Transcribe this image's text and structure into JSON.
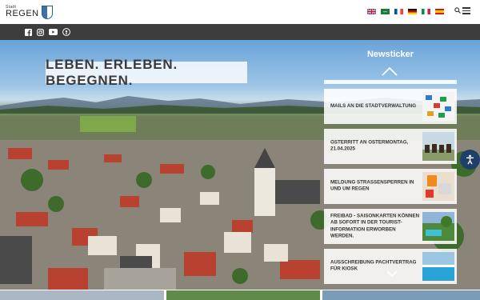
{
  "header": {
    "logo_small": "Stadt",
    "logo_big": "REGEN",
    "languages": [
      "english",
      "arabic",
      "french",
      "german",
      "italian",
      "spanish"
    ]
  },
  "social": {
    "icons": [
      "facebook-icon",
      "instagram-icon",
      "youtube-icon",
      "podcast-icon"
    ]
  },
  "hero": {
    "slogan": "LEBEN. ERLEBEN. BEGEGNEN."
  },
  "newsticker": {
    "title": "Newsticker",
    "items": [
      {
        "text": "MAILS AN DIE STADTVERWALTUNG"
      },
      {
        "text": "OSTERRITT AN OSTERMONTAG, 21.04.2025"
      },
      {
        "text": "MELDUNG STRASSENSPERREN IN UND UM REGEN"
      },
      {
        "text": "FREIBAD - SAISONKARTEN KÖNNEN AB SOFORT IN DER TOURIST-INFORMATION ERWORBEN WERDEN."
      },
      {
        "text": "AUSSCHREIBUNG PACHTVERTRAG FÜR KIOSK"
      }
    ]
  },
  "colors": {
    "topbar": "#ffffff",
    "socialbar": "#3d3d3d",
    "accessibility": "#1f3f6b"
  }
}
